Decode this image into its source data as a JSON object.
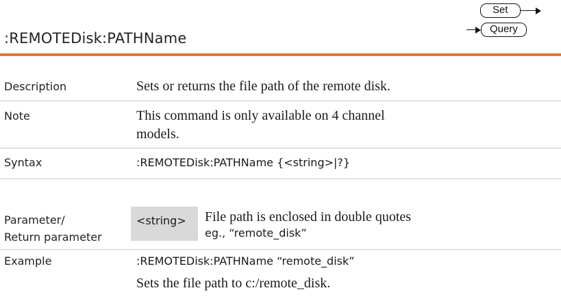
{
  "badges": {
    "set": "Set",
    "query": "Query"
  },
  "heading": ":REMOTEDisk:PATHName",
  "rows": {
    "description": {
      "label": "Description",
      "value": "Sets or returns the file path of the remote disk."
    },
    "note": {
      "label": "Note",
      "value_line1": "This command is only available on 4 channel",
      "value_line2": "models."
    },
    "syntax": {
      "label": "Syntax",
      "value": ":REMOTEDisk:PATHName {<string>|?}"
    },
    "parameter": {
      "label_line1": "Parameter/",
      "label_line2": "Return parameter",
      "name": "<string>",
      "desc_line1": "File path is enclosed in double quotes",
      "desc_line2": "eg., “remote_disk”"
    },
    "example": {
      "label": "Example",
      "command": ":REMOTEDisk:PATHName “remote_disk”",
      "explanation": "Sets the file path to c:/remote_disk."
    }
  }
}
